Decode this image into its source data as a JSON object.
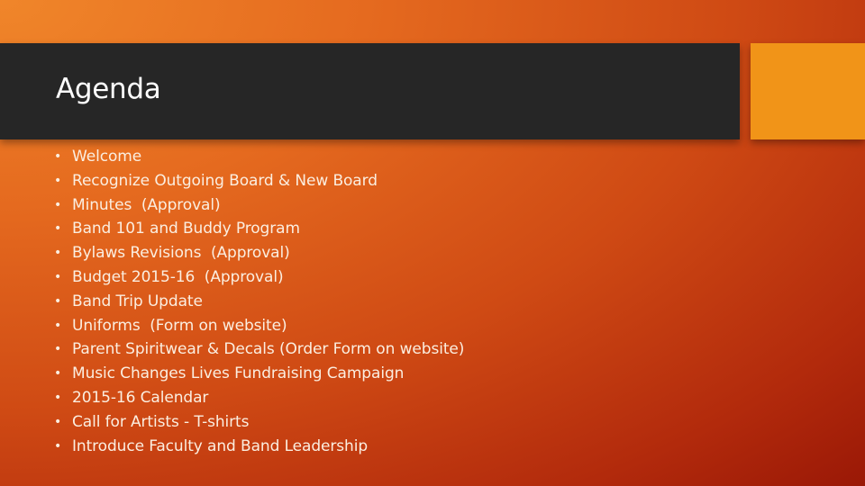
{
  "slide": {
    "title": "Agenda",
    "colors": {
      "title_bar": "#262626",
      "accent_block": "#f19418",
      "background_top_left": "#f0862a",
      "background_bottom_right": "#9a1806",
      "text": "#fbeee0"
    },
    "bullet_glyph": "•",
    "items": [
      {
        "label": "Welcome"
      },
      {
        "label": "Recognize Outgoing Board & New Board"
      },
      {
        "label": "Minutes  (Approval)"
      },
      {
        "label": "Band 101 and Buddy Program"
      },
      {
        "label": "Bylaws Revisions  (Approval)"
      },
      {
        "label": "Budget 2015-16  (Approval)"
      },
      {
        "label": "Band Trip Update"
      },
      {
        "label": "Uniforms  (Form on website)"
      },
      {
        "label": "Parent Spiritwear & Decals (Order Form on website)"
      },
      {
        "label": "Music Changes Lives Fundraising Campaign"
      },
      {
        "label": "2015-16 Calendar"
      },
      {
        "label": "Call for Artists - T-shirts"
      },
      {
        "label": "Introduce Faculty and Band Leadership"
      }
    ]
  }
}
